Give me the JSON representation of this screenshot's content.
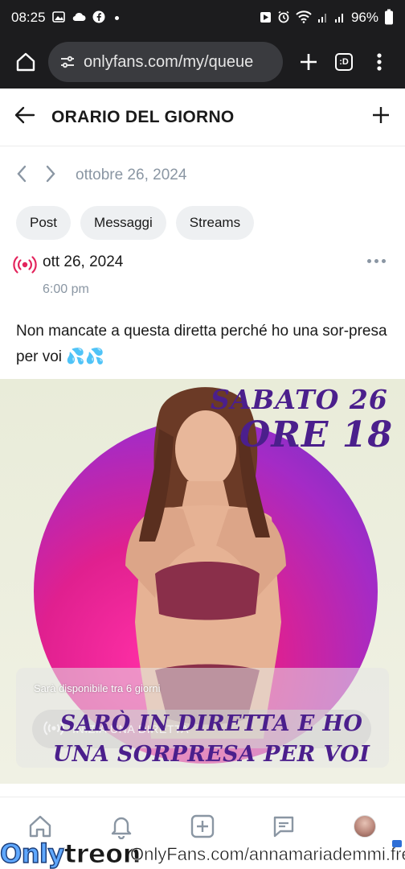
{
  "status_bar": {
    "time": "08:25",
    "battery": "96%"
  },
  "browser": {
    "url": "onlyfans.com/my/queue",
    "tab_count": ":D"
  },
  "header": {
    "title": "ORARIO DEL GIORNO"
  },
  "date_nav": {
    "date": "ottobre 26, 2024"
  },
  "filters": [
    {
      "label": "Post"
    },
    {
      "label": "Messaggi"
    },
    {
      "label": "Streams"
    }
  ],
  "post": {
    "date": "ott 26, 2024",
    "time": "6:00 pm",
    "text": "Non mancate a questa diretta perché ho una sor-presa per voi 💦💦",
    "image_headline_top": "SABATO 26",
    "image_headline_top2": "ORE 18",
    "image_headline_bottom": "SARÒ IN DIRETTA E HO UNA SORPRESA PER VOI",
    "availability_text": "Sarà disponibile tra 6 giorni",
    "start_live_label": "INIZIA UNA DIRETTA"
  },
  "watermark": {
    "logo_only": "Only",
    "logo_treon": "treon",
    "url": "OnlyFans.com/annamariademmi.free"
  },
  "colors": {
    "accent": "#00aff0",
    "muted_text": "#8a96a3",
    "live_icon": "#e3245c",
    "headline_purple": "#4b1f8c"
  }
}
